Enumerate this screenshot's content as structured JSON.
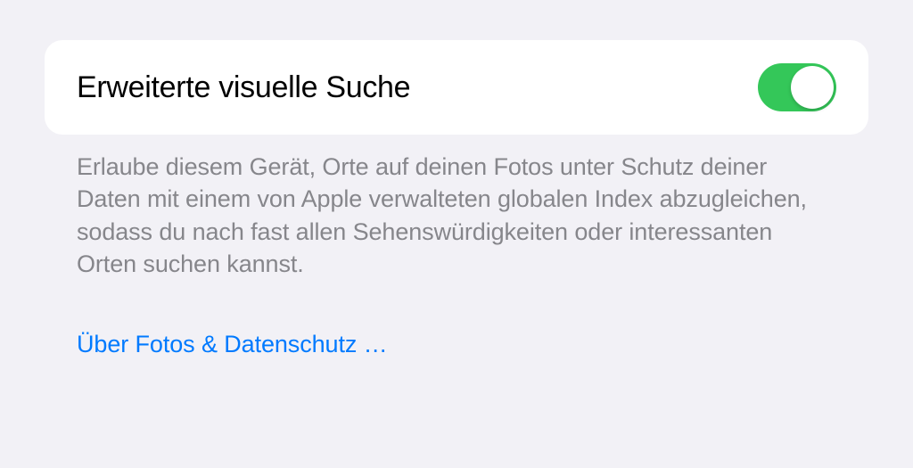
{
  "setting": {
    "title": "Erweiterte visuelle Suche",
    "enabled": true,
    "description": "Erlaube diesem Gerät, Orte auf deinen Fotos unter Schutz deiner Daten mit einem von Apple verwalteten globalen Index abzugleichen, sodass du nach fast allen Sehenswürdigkeiten oder interessanten Orten suchen kannst."
  },
  "privacy_link": {
    "label": "Über Fotos & Datenschutz …"
  },
  "colors": {
    "toggle_on": "#34c759",
    "link": "#007aff",
    "description": "#86868b"
  }
}
